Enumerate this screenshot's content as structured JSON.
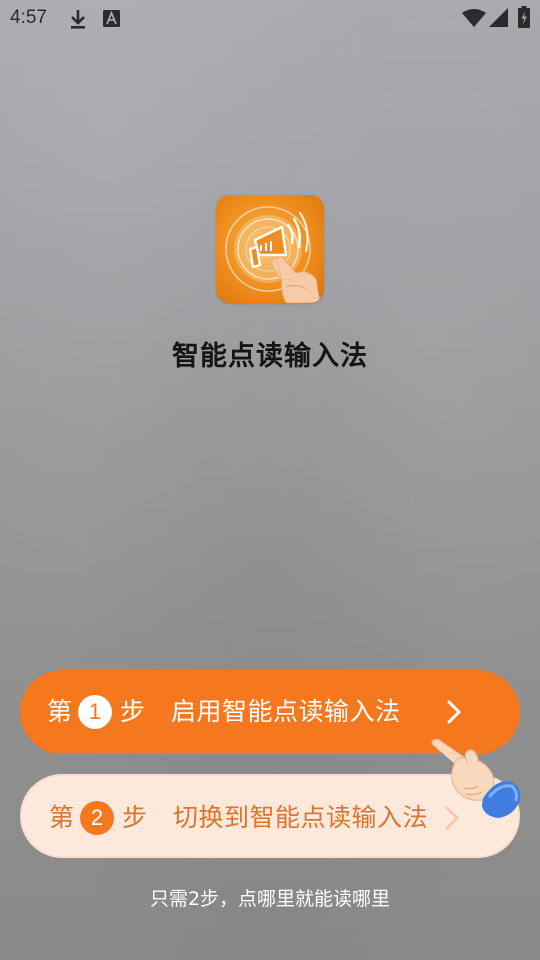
{
  "status_bar": {
    "time": "4:57",
    "icons": [
      "download-icon",
      "keyboard-a-icon",
      "wifi-icon",
      "signal-icon",
      "battery-charging-icon"
    ]
  },
  "app": {
    "name": "智能点读输入法",
    "logo_icon": "megaphone-touch-icon",
    "brand_color": "#f5781f"
  },
  "steps": [
    {
      "prefix": "第",
      "number": "1",
      "suffix": "步",
      "label": "启用智能点读输入法",
      "icon": "chevron-right-icon"
    },
    {
      "prefix": "第",
      "number": "2",
      "suffix": "步",
      "label": "切换到智能点读输入法",
      "icon": "chevron-right-icon"
    }
  ],
  "hint": "只需2步，点哪里就能读哪里",
  "pointer_icon": "pointing-hand-icon"
}
